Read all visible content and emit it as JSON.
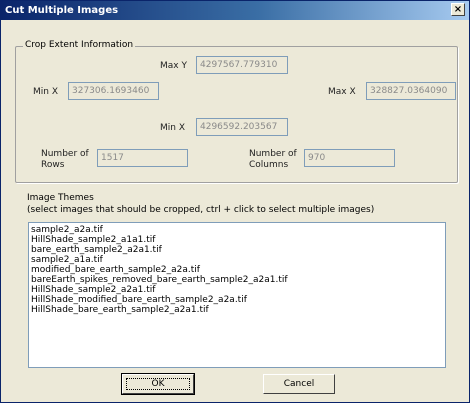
{
  "window": {
    "title": "Cut Multiple Images",
    "close_label": "×"
  },
  "crop_extent": {
    "legend": "Crop Extent Information",
    "max_y": {
      "label": "Max Y",
      "value": "4297567.779310"
    },
    "min_x_left": {
      "label": "Min X",
      "value": "327306.1693460"
    },
    "max_x": {
      "label": "Max X",
      "value": "328827.0364090"
    },
    "min_x_bottom": {
      "label": "Min X",
      "value": "4296592.203567"
    },
    "rows": {
      "label_line1": "Number of",
      "label_line2": "Rows",
      "value": "1517"
    },
    "columns": {
      "label_line1": "Number of",
      "label_line2": "Columns",
      "value": "970"
    }
  },
  "themes": {
    "label_line1": "Image Themes",
    "label_line2": "(select images that should be cropped, ctrl + click to select multiple images)",
    "items": [
      "sample2_a2a.tif",
      "HillShade_sample2_a1a1.tif",
      "bare_earth_sample2_a2a1.tif",
      "sample2_a1a.tif",
      "modified_bare_earth_sample2_a2a.tif",
      "bareEarth_spikes_removed_bare_earth_sample2_a2a1.tif",
      "HillShade_sample2_a2a1.tif",
      "HillShade_modified_bare_earth_sample2_a2a.tif",
      "HillShade_bare_earth_sample2_a2a1.tif"
    ]
  },
  "buttons": {
    "ok": "OK",
    "cancel": "Cancel"
  }
}
